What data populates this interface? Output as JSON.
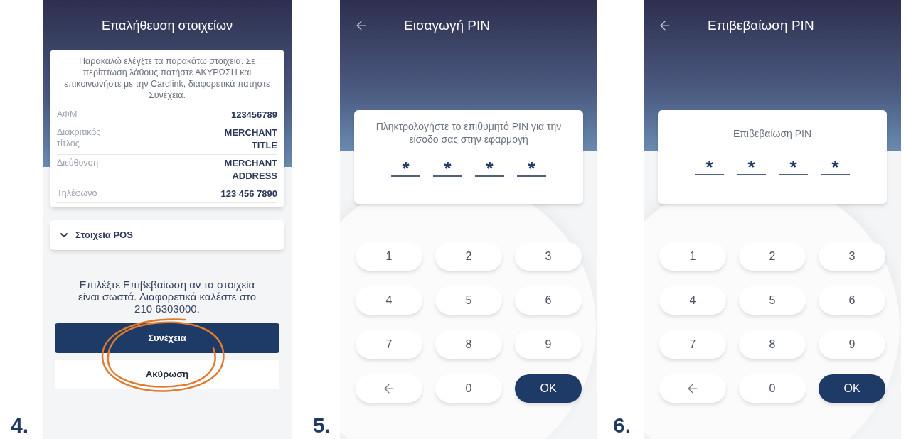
{
  "screens": [
    {
      "kind": "verify",
      "step": "4.",
      "title": "Επαλήθευση στοιχείων",
      "intro": "Παρακαλώ ελέγξτε τα παρακάτω στοιχεία. Σε περίπτωση λάθους πατήστε ΑΚΥΡΩΣΗ και επικοινωνήστε με την Cardlink, διαφορετικά πατήστε Συνέχεια.",
      "rows": [
        {
          "label": "ΑΦΜ",
          "value": "123456789"
        },
        {
          "label": "Διακριτικός τίτλος",
          "value": "MERCHANT TITLE"
        },
        {
          "label": "Διεύθυνση",
          "value": "MERCHANT ADDRESS"
        },
        {
          "label": "Τηλέφωνο",
          "value": "123 456 7890"
        }
      ],
      "section": {
        "label": "Στοιχεία POS",
        "expanded": false
      },
      "message": "Επιλέξτε Επιβεβαίωση αν τα στοιχεία είναι σωστά. Διαφορετικά καλέστε στο 210 6303000.",
      "primary": "Συνέχεια",
      "secondary": "Ακύρωση"
    },
    {
      "kind": "pin",
      "step": "5.",
      "title": "Εισαγωγή PIN",
      "prompt": "Πληκτρολογήστε το επιθυμητό PIN για την είσοδο σας στην εφαρμογή",
      "pin": [
        "*",
        "*",
        "*",
        "*"
      ],
      "keys": [
        {
          "kind": "digit",
          "label": "1"
        },
        {
          "kind": "digit",
          "label": "2"
        },
        {
          "kind": "digit",
          "label": "3"
        },
        {
          "kind": "digit",
          "label": "4"
        },
        {
          "kind": "digit",
          "label": "5"
        },
        {
          "kind": "digit",
          "label": "6"
        },
        {
          "kind": "digit",
          "label": "7"
        },
        {
          "kind": "digit",
          "label": "8"
        },
        {
          "kind": "digit",
          "label": "9"
        },
        {
          "kind": "back"
        },
        {
          "kind": "digit",
          "label": "0"
        },
        {
          "kind": "ok",
          "label": "OK"
        }
      ]
    },
    {
      "kind": "pin",
      "step": "6.",
      "title": "Επιβεβαίωση PIN",
      "prompt": "Επιβεβαίωση PIN",
      "pin": [
        "*",
        "*",
        "*",
        "*"
      ],
      "keys": [
        {
          "kind": "digit",
          "label": "1"
        },
        {
          "kind": "digit",
          "label": "2"
        },
        {
          "kind": "digit",
          "label": "3"
        },
        {
          "kind": "digit",
          "label": "4"
        },
        {
          "kind": "digit",
          "label": "5"
        },
        {
          "kind": "digit",
          "label": "6"
        },
        {
          "kind": "digit",
          "label": "7"
        },
        {
          "kind": "digit",
          "label": "8"
        },
        {
          "kind": "digit",
          "label": "9"
        },
        {
          "kind": "back"
        },
        {
          "kind": "digit",
          "label": "0"
        },
        {
          "kind": "ok",
          "label": "OK"
        }
      ]
    }
  ]
}
